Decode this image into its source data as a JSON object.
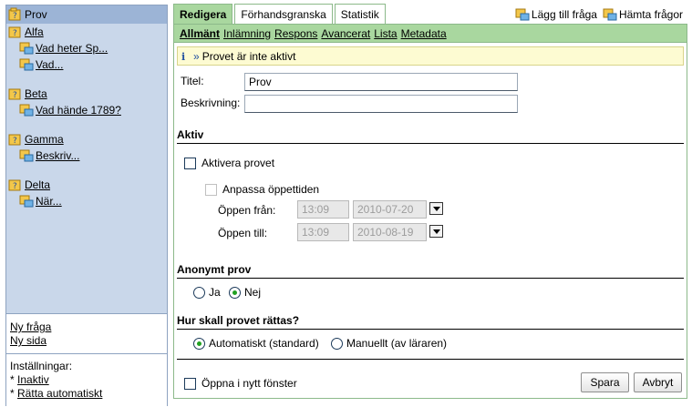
{
  "sidebar": {
    "root_label": "Prov",
    "groups": [
      {
        "label": "Alfa",
        "items": [
          "Vad heter Sp...",
          "Vad..."
        ]
      },
      {
        "label": "Beta",
        "items": [
          "Vad hände 1789?"
        ]
      },
      {
        "label": "Gamma",
        "items": [
          "Beskriv..."
        ]
      },
      {
        "label": "Delta",
        "items": [
          "När..."
        ]
      }
    ],
    "links": {
      "new_question": "Ny fråga",
      "new_page": "Ny sida"
    },
    "settings": {
      "heading": "Inställningar:",
      "inactive_prefix": "* ",
      "inactive": "Inaktiv",
      "auto_prefix": "* ",
      "auto_grade": "Rätta automatiskt"
    }
  },
  "tabs": [
    "Redigera",
    "Förhandsgranska",
    "Statistik"
  ],
  "top_actions": {
    "add_question": "Lägg till fråga",
    "fetch_questions": "Hämta frågor"
  },
  "subtabs": [
    "Allmänt",
    "Inlämning",
    "Respons",
    "Avancerat",
    "Lista",
    "Metadata"
  ],
  "notice": "Provet är inte aktivt",
  "form": {
    "title_label": "Titel:",
    "title_value": "Prov",
    "description_label": "Beskrivning:",
    "description_value": "",
    "section_active": "Aktiv",
    "activate_label": "Aktivera provet",
    "adjust_label": "Anpassa öppettiden",
    "open_from_label": "Öppen från:",
    "open_from_time": "13:09",
    "open_from_date": "2010-07-20",
    "open_to_label": "Öppen till:",
    "open_to_time": "13:09",
    "open_to_date": "2010-08-19",
    "section_anonymous": "Anonymt prov",
    "yes_label": "Ja",
    "no_label": "Nej",
    "anonymous_selected": "Nej",
    "section_grading": "Hur skall provet rättas?",
    "auto_label": "Automatiskt (standard)",
    "manual_label": "Manuellt (av läraren)",
    "grading_selected": "Automatiskt (standard)",
    "new_window_label": "Öppna i nytt fönster"
  },
  "buttons": {
    "save": "Spara",
    "cancel": "Avbryt"
  },
  "colors": {
    "tab_active": "#a9d79f",
    "sidebar_bg": "#c9d7ea",
    "notice_bg": "#fdfbd2"
  }
}
